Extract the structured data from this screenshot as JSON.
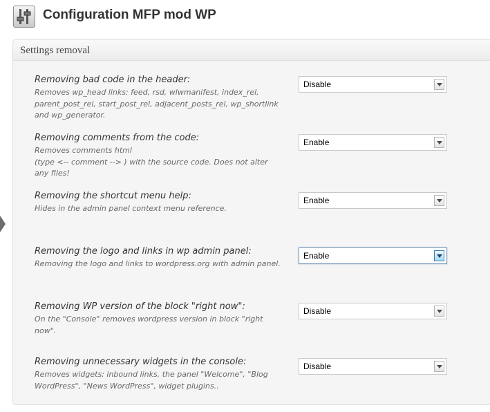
{
  "header": {
    "title": "Configuration MFP mod WP",
    "icon": "settings-sliders-icon"
  },
  "panel": {
    "title": "Settings removal"
  },
  "settings": [
    {
      "title": "Removing bad code in the header:",
      "description": "Removes wp_head links: feed, rsd, wlwmanifest, index_rel, parent_post_rel, start_post_rel, adjacent_posts_rel, wp_shortlink and wp_generator.",
      "value": "Disable"
    },
    {
      "title": "Removing comments from the code:",
      "description_lines": [
        "Removes comments html",
        "(type <-- comment --> ) with the source code. Does not alter any files!"
      ],
      "value": "Enable"
    },
    {
      "title": "Removing the shortcut menu help:",
      "description": "Hides in the admin panel context menu reference.",
      "value": "Enable"
    },
    {
      "title": "Removing the logo and links in wp admin panel:",
      "description": "Removing the logo and links to wordpress.org with admin panel.",
      "value": "Enable",
      "focused": true
    },
    {
      "title": "Removing WP version of the block \"right now\":",
      "description": "On the \"Console\" removes wordpress version in block \"right now\".",
      "value": "Disable"
    },
    {
      "title": "Removing unnecessary widgets in the console:",
      "description": "Removes widgets: inbound links, the panel \"Welcome\", \"Blog WordPress\", \"News WordPress\", widget plugins..",
      "value": "Disable"
    }
  ],
  "colors": {
    "panel_bg": "#f5f5f5",
    "panel_border": "#dfdfdf",
    "title_text": "#333333",
    "description_text": "#666666"
  }
}
